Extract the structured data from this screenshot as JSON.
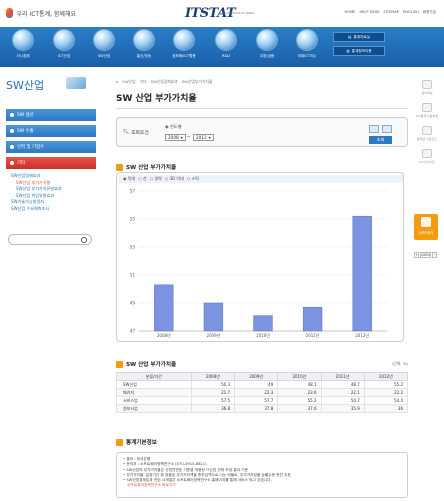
{
  "header": {
    "tagline": "우리 ICT통계, 함께해요",
    "brand": "ITSTAT",
    "brand_sub": "IT STATISTICS OF KOREA",
    "util_links": [
      "HOME",
      "HELP DESK",
      "SITEMAP",
      "ENGLISH",
      "회원가입"
    ]
  },
  "nav": {
    "items": [
      {
        "label": "거시경제"
      },
      {
        "label": "ICT산업"
      },
      {
        "label": "SW산업"
      },
      {
        "label": "통신/방송"
      },
      {
        "label": "정보화/ICT활용"
      },
      {
        "label": "R&D"
      },
      {
        "label": "우편/금융"
      },
      {
        "label": "국제ICT지수"
      }
    ],
    "buttons": [
      "통계자료실",
      "통계정보이용"
    ]
  },
  "sidebar": {
    "title": "SW산업",
    "items": [
      {
        "label": "SW 생산"
      },
      {
        "label": "SW 수출"
      },
      {
        "label": "인력 및 기업수"
      },
      {
        "label": "기타"
      }
    ],
    "sub": {
      "group1": "SW산업경제효과",
      "children": [
        "SW산업 부가가치율",
        "SW산업 부가가치유발효과",
        "SW산업 취업유발효과"
      ],
      "group2": "SW기술가능발생지",
      "group3": "SW산업 수요예측조사"
    }
  },
  "main": {
    "breadcrumbs": [
      "⌂",
      "SW산업",
      "기타",
      "SW산업경제효과",
      "SW산업부가가치율"
    ],
    "title": "SW 산업 부가가치율",
    "condition": {
      "label": "조회조건",
      "period_type": "연도별",
      "start_year": "2008",
      "end_year": "2012",
      "separator": "~",
      "search_label": "조회"
    },
    "chart_title": "SW 산업 부가가치율",
    "chart_options": [
      "막대",
      "선",
      "영역",
      "3D 막대",
      "스탁"
    ],
    "table_title": "SW 산업 부가가치율",
    "table_unit": "(단위: %)",
    "info_title": "통계기본정보",
    "info_lines": [
      "출처 : 한국은행",
      "문의처 : 소프트웨어정책연구소 (070-4915-8811)",
      "SW산업의 부가가치율은 산업연관표 기준을 적용한 IT산업 전체 추정 결과 기준",
      "부가가치율: 일정기간 중 창출된 부가가치액을 총투입액으로 나눈 비율로, 부가가치창출 능률수준 판단 지표",
      "SW산업경제효과 관련 시계열은 소프트웨어정책연구소 홈페이지를 통해 서비스 되고 있습니다."
    ],
    "info_link": "소프트웨어정책연구소 바로가기"
  },
  "chart_data": {
    "type": "bar",
    "categories": [
      "2008년",
      "2009년",
      "2010년",
      "2011년",
      "2012년"
    ],
    "values": [
      50.3,
      49.0,
      48.1,
      48.7,
      55.2
    ],
    "yticks": [
      47,
      49,
      51,
      53,
      55,
      57
    ],
    "ylim": [
      47,
      57
    ],
    "grid": true,
    "color": "#7b93e0"
  },
  "table": {
    "columns": [
      "분류/기간",
      "2008년",
      "2009년",
      "2010년",
      "2011년",
      "2012년"
    ],
    "rows": [
      [
        "SW산업",
        "50.3",
        "49",
        "48.1",
        "48.7",
        "55.2"
      ],
      [
        "패키지",
        "21.7",
        "22.3",
        "23.6",
        "22.1",
        "22.2"
      ],
      [
        "서비스업",
        "57.5",
        "57.7",
        "55.2",
        "54.7",
        "54.4"
      ],
      [
        "정보사업",
        "36.8",
        "37.8",
        "37.6",
        "35.9",
        "36"
      ]
    ]
  },
  "rail": {
    "items": [
      "용어해설",
      "ICT통계 이용방법",
      "통계표 다운로드",
      "ICT인사이트"
    ],
    "orange": "서비스문의",
    "zoom": [
      "+",
      "100%",
      "−"
    ]
  },
  "colors": {
    "nav": "#1f6fb8",
    "accent": "#f39c12",
    "bar": "#7b93e0"
  }
}
